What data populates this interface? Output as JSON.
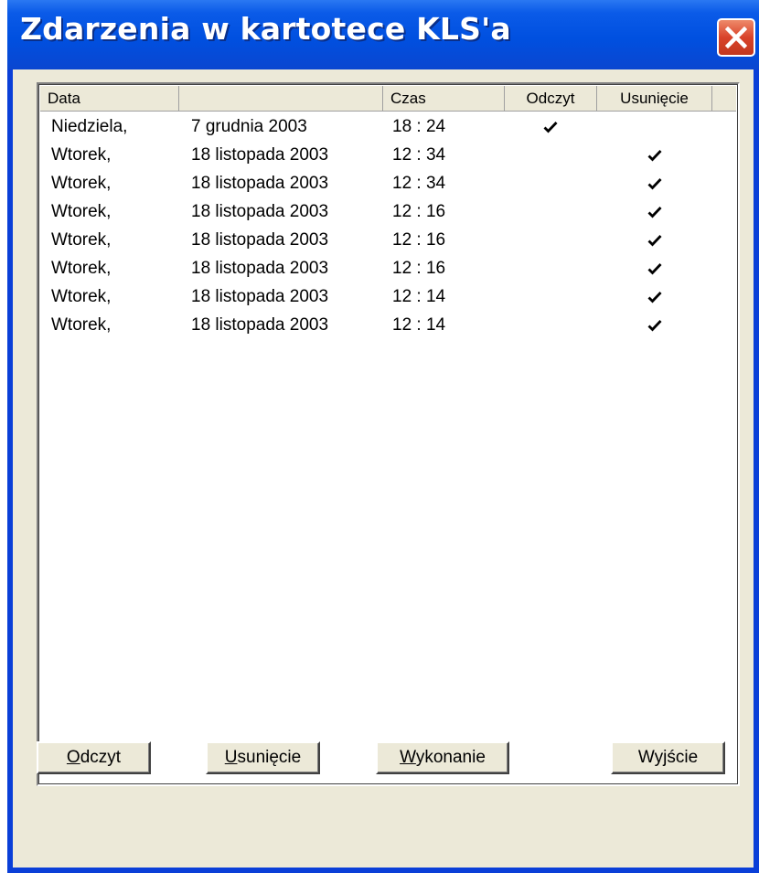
{
  "window": {
    "title": "Zdarzenia w kartotece KLS'a"
  },
  "list": {
    "columns": [
      "Data",
      "",
      "Czas",
      "Odczyt",
      "Usunięcie"
    ],
    "rows": [
      {
        "day": "Niedziela,",
        "date": "7 grudnia 2003",
        "time": "18 : 24",
        "read": true,
        "deleted": false
      },
      {
        "day": "Wtorek,",
        "date": "18 listopada 2003",
        "time": "12 : 34",
        "read": false,
        "deleted": true
      },
      {
        "day": "Wtorek,",
        "date": "18 listopada 2003",
        "time": "12 : 34",
        "read": false,
        "deleted": true
      },
      {
        "day": "Wtorek,",
        "date": "18 listopada 2003",
        "time": "12 : 16",
        "read": false,
        "deleted": true
      },
      {
        "day": "Wtorek,",
        "date": "18 listopada 2003",
        "time": "12 : 16",
        "read": false,
        "deleted": true
      },
      {
        "day": "Wtorek,",
        "date": "18 listopada 2003",
        "time": "12 : 16",
        "read": false,
        "deleted": true
      },
      {
        "day": "Wtorek,",
        "date": "18 listopada 2003",
        "time": "12 : 14",
        "read": false,
        "deleted": true
      },
      {
        "day": "Wtorek,",
        "date": "18 listopada 2003",
        "time": "12 : 14",
        "read": false,
        "deleted": true
      }
    ]
  },
  "buttons": {
    "read": {
      "accel": "O",
      "rest": "dczyt"
    },
    "delete": {
      "accel": "U",
      "rest": "sunięcie"
    },
    "execute": {
      "accel": "W",
      "rest": "ykonanie"
    },
    "exit": {
      "label": "Wyjście"
    }
  },
  "colors": {
    "titlebar": "#0050e0",
    "close": "#d9432a",
    "face": "#ece9d8"
  },
  "icons": {
    "close": "close-icon",
    "check": "checkmark-icon"
  }
}
